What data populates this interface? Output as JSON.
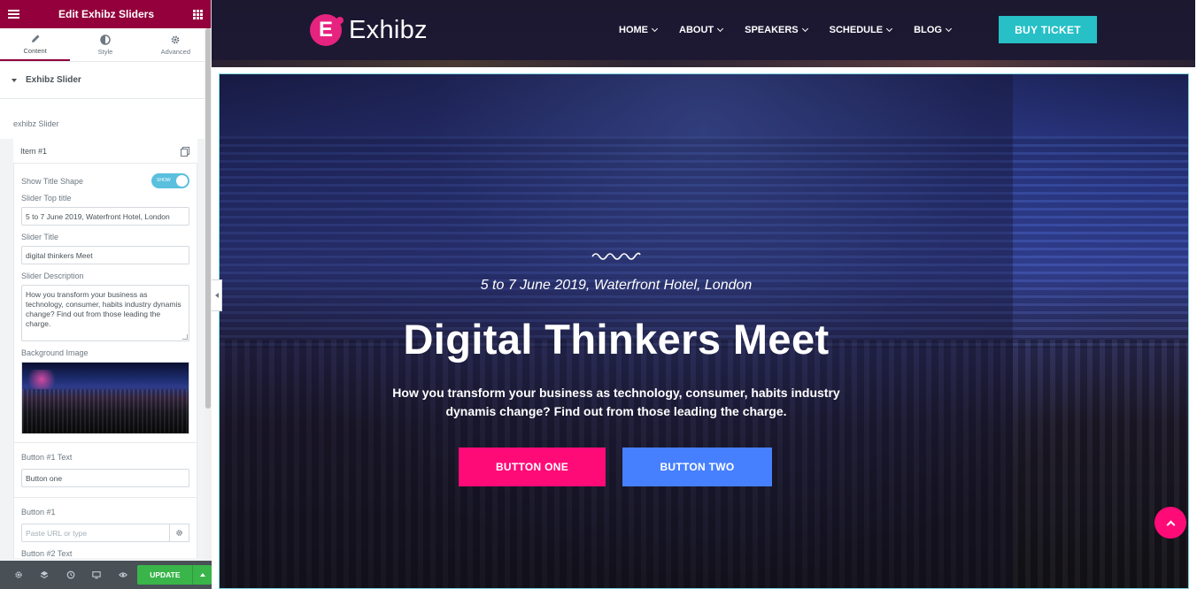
{
  "editor": {
    "header_title": "Edit Exhibz Sliders",
    "tabs": [
      {
        "label": "Content",
        "icon": "pencil-icon"
      },
      {
        "label": "Style",
        "icon": "contrast-icon"
      },
      {
        "label": "Advanced",
        "icon": "gear-icon"
      }
    ],
    "section_title": "Exhibz Slider",
    "repeater_label": "exhibz Slider",
    "item_title": "Item #1",
    "show_title_shape": {
      "label": "Show Title Shape",
      "toggle_text": "SHOW",
      "state": "on"
    },
    "slider_top_title": {
      "label": "Slider Top title",
      "value": "5 to 7 June 2019, Waterfront Hotel, London"
    },
    "slider_title": {
      "label": "Slider Title",
      "value": "digital thinkers Meet"
    },
    "slider_description": {
      "label": "Slider Description",
      "value": "How you transform your business as technology, consumer, habits industry dynamis change? Find out from those leading the charge."
    },
    "background_image": {
      "label": "Background Image"
    },
    "button1_text": {
      "label": "Button #1 Text",
      "value": "Button one"
    },
    "button1_url": {
      "label": "Button #1",
      "placeholder": "Paste URL or type"
    },
    "button2_text": {
      "label": "Button #2 Text"
    },
    "footer": {
      "update_label": "UPDATE"
    }
  },
  "site": {
    "logo_letter": "E",
    "logo_text": "Exhibz",
    "nav": [
      "HOME",
      "ABOUT",
      "SPEAKERS",
      "SCHEDULE",
      "BLOG"
    ],
    "buy_ticket": "BUY TICKET",
    "hero": {
      "top_title": "5 to 7 June 2019, Waterfront Hotel, London",
      "title": "Digital Thinkers Meet",
      "description": "How you transform your business as technology, consumer, habits industry dynamis change? Find out from those leading the charge.",
      "button_one": "BUTTON ONE",
      "button_two": "BUTTON TWO"
    }
  },
  "colors": {
    "editor_accent": "#93003c",
    "update_green": "#39b54a",
    "buy_ticket": "#26c0c6",
    "button_one": "#ff0b78",
    "button_two": "#4680ff"
  }
}
